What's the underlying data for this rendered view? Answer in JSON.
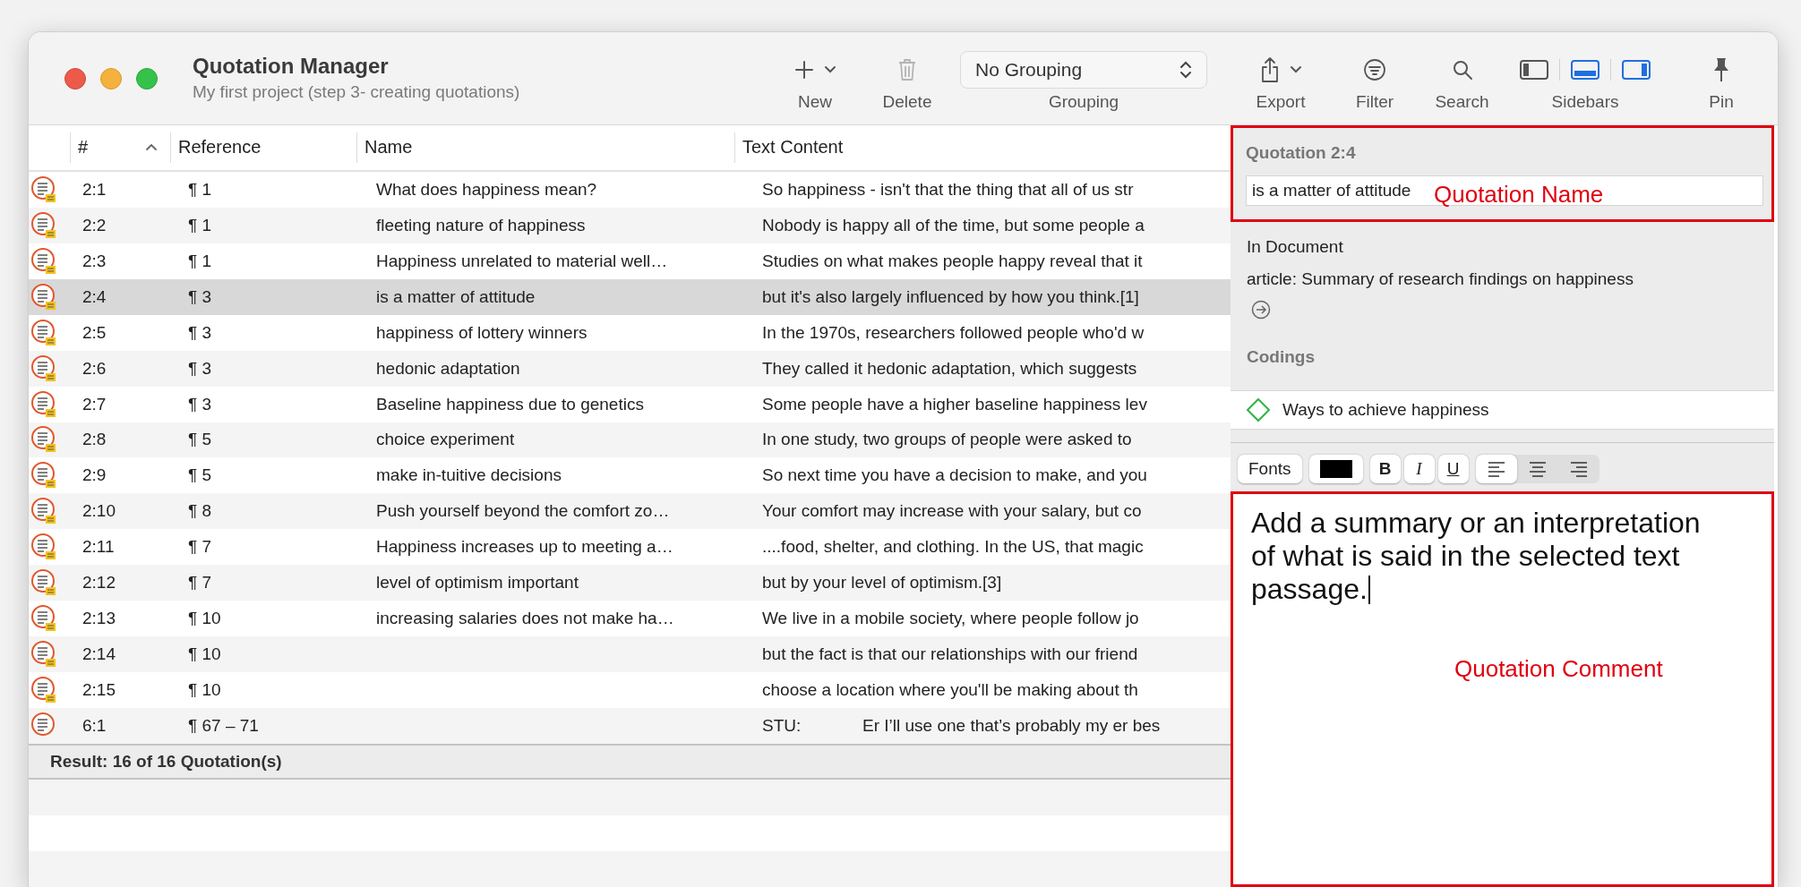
{
  "window": {
    "title": "Quotation Manager",
    "subtitle": "My first project (step 3- creating quotations)"
  },
  "toolbar": {
    "items": [
      {
        "kind": "new",
        "label": "New"
      },
      {
        "kind": "delete",
        "label": "Delete",
        "disabled": true
      },
      {
        "kind": "grouping",
        "label": "Grouping",
        "value": "No Grouping"
      },
      {
        "kind": "export",
        "label": "Export"
      },
      {
        "kind": "filter",
        "label": "Filter"
      },
      {
        "kind": "search",
        "label": "Search"
      },
      {
        "kind": "sidebars",
        "label": "Sidebars",
        "toggles": [
          {
            "kind": "left",
            "on": false
          },
          {
            "kind": "bottom",
            "on": true
          },
          {
            "kind": "right",
            "on": true
          }
        ]
      },
      {
        "kind": "pin",
        "label": "Pin"
      }
    ]
  },
  "table": {
    "columns": [
      {
        "label": "#",
        "sorted": true
      },
      {
        "label": "Reference",
        "sorted": false
      },
      {
        "label": "Name",
        "sorted": false
      },
      {
        "label": "Text Content",
        "sorted": false
      }
    ],
    "rows": [
      {
        "number": "2:1",
        "reference": "¶ 1",
        "name": "What does happiness mean?",
        "text": "So happiness - isn't that the thing that all of us str",
        "has_comment": true,
        "selected": false
      },
      {
        "number": "2:2",
        "reference": "¶ 1",
        "name": "fleeting nature of happiness",
        "text": "Nobody is happy all of the time, but some people a",
        "has_comment": true,
        "selected": false
      },
      {
        "number": "2:3",
        "reference": "¶ 1",
        "name": "Happiness unrelated to material well…",
        "text": "Studies on what makes people happy reveal that it",
        "has_comment": true,
        "selected": false
      },
      {
        "number": "2:4",
        "reference": "¶ 3",
        "name": "is a matter of attitude",
        "text": "but it's also largely influenced by how you think.[1]",
        "has_comment": true,
        "selected": true
      },
      {
        "number": "2:5",
        "reference": "¶ 3",
        "name": "happiness of lottery winners",
        "text": "In the 1970s, researchers followed people who'd w",
        "has_comment": true,
        "selected": false
      },
      {
        "number": "2:6",
        "reference": "¶ 3",
        "name": "hedonic adaptation",
        "text": "They called it hedonic adaptation, which suggests",
        "has_comment": true,
        "selected": false
      },
      {
        "number": "2:7",
        "reference": "¶ 3",
        "name": "Baseline happiness due to genetics",
        "text": "Some people have a higher baseline happiness lev",
        "has_comment": true,
        "selected": false
      },
      {
        "number": "2:8",
        "reference": "¶ 5",
        "name": "choice experiment",
        "text": "In one study, two groups of people were asked to",
        "has_comment": true,
        "selected": false
      },
      {
        "number": "2:9",
        "reference": "¶ 5",
        "name": "make in-tuitive decisions",
        "text": "So next time you have a decision to make, and you",
        "has_comment": true,
        "selected": false
      },
      {
        "number": "2:10",
        "reference": "¶ 8",
        "name": "Push yourself beyond the comfort zo…",
        "text": "Your comfort may increase with your salary, but co",
        "has_comment": true,
        "selected": false
      },
      {
        "number": "2:11",
        "reference": "¶ 7",
        "name": "Happiness increases up to meeting a…",
        "text": "....food, shelter, and clothing. In the US, that magic",
        "has_comment": true,
        "selected": false
      },
      {
        "number": "2:12",
        "reference": "¶ 7",
        "name": "level of optimism important",
        "text": "but by your level of optimism.[3]",
        "has_comment": true,
        "selected": false
      },
      {
        "number": "2:13",
        "reference": "¶ 10",
        "name": "increasing salaries does not make ha…",
        "text": "We live in a mobile society, where people follow jo",
        "has_comment": true,
        "selected": false
      },
      {
        "number": "2:14",
        "reference": "¶ 10",
        "text": "but the fact is that our relationships with our friend",
        "has_comment": true,
        "selected": false
      },
      {
        "number": "2:15",
        "reference": "¶ 10",
        "text": "choose a location where you'll be making about th",
        "has_comment": true,
        "selected": false
      },
      {
        "number": "6:1",
        "reference": "¶ 67 – 71",
        "speaker": "STU:",
        "text": "Er I’ll use one that’s probably my er bes",
        "has_comment": false,
        "selected": false
      }
    ]
  },
  "status_bar": {
    "result": "Result: 16 of 16 Quotation(s)"
  },
  "inspector": {
    "heading": "Quotation 2:4",
    "name_value": "is a matter of attitude",
    "document_label": "In Document",
    "document": "article: Summary of research findings on happiness",
    "codings_label": "Codings",
    "codings": [
      {
        "name": "Ways to achieve happiness",
        "color": "#2fb344"
      }
    ],
    "format_bar": {
      "fonts": "Fonts",
      "styles": [
        {
          "kind": "bold",
          "label": "B"
        },
        {
          "kind": "italic",
          "label": "I"
        },
        {
          "kind": "underline",
          "label": "U"
        }
      ],
      "alignments": [
        {
          "kind": "left",
          "selected": true
        },
        {
          "kind": "center",
          "selected": false
        },
        {
          "kind": "right",
          "selected": false
        }
      ]
    },
    "comment": "Add a summary or an interpretation of what is said in the selected text passage."
  },
  "annotations": [
    {
      "label": "Quotation Name"
    },
    {
      "label": "Quotation Comment"
    }
  ]
}
